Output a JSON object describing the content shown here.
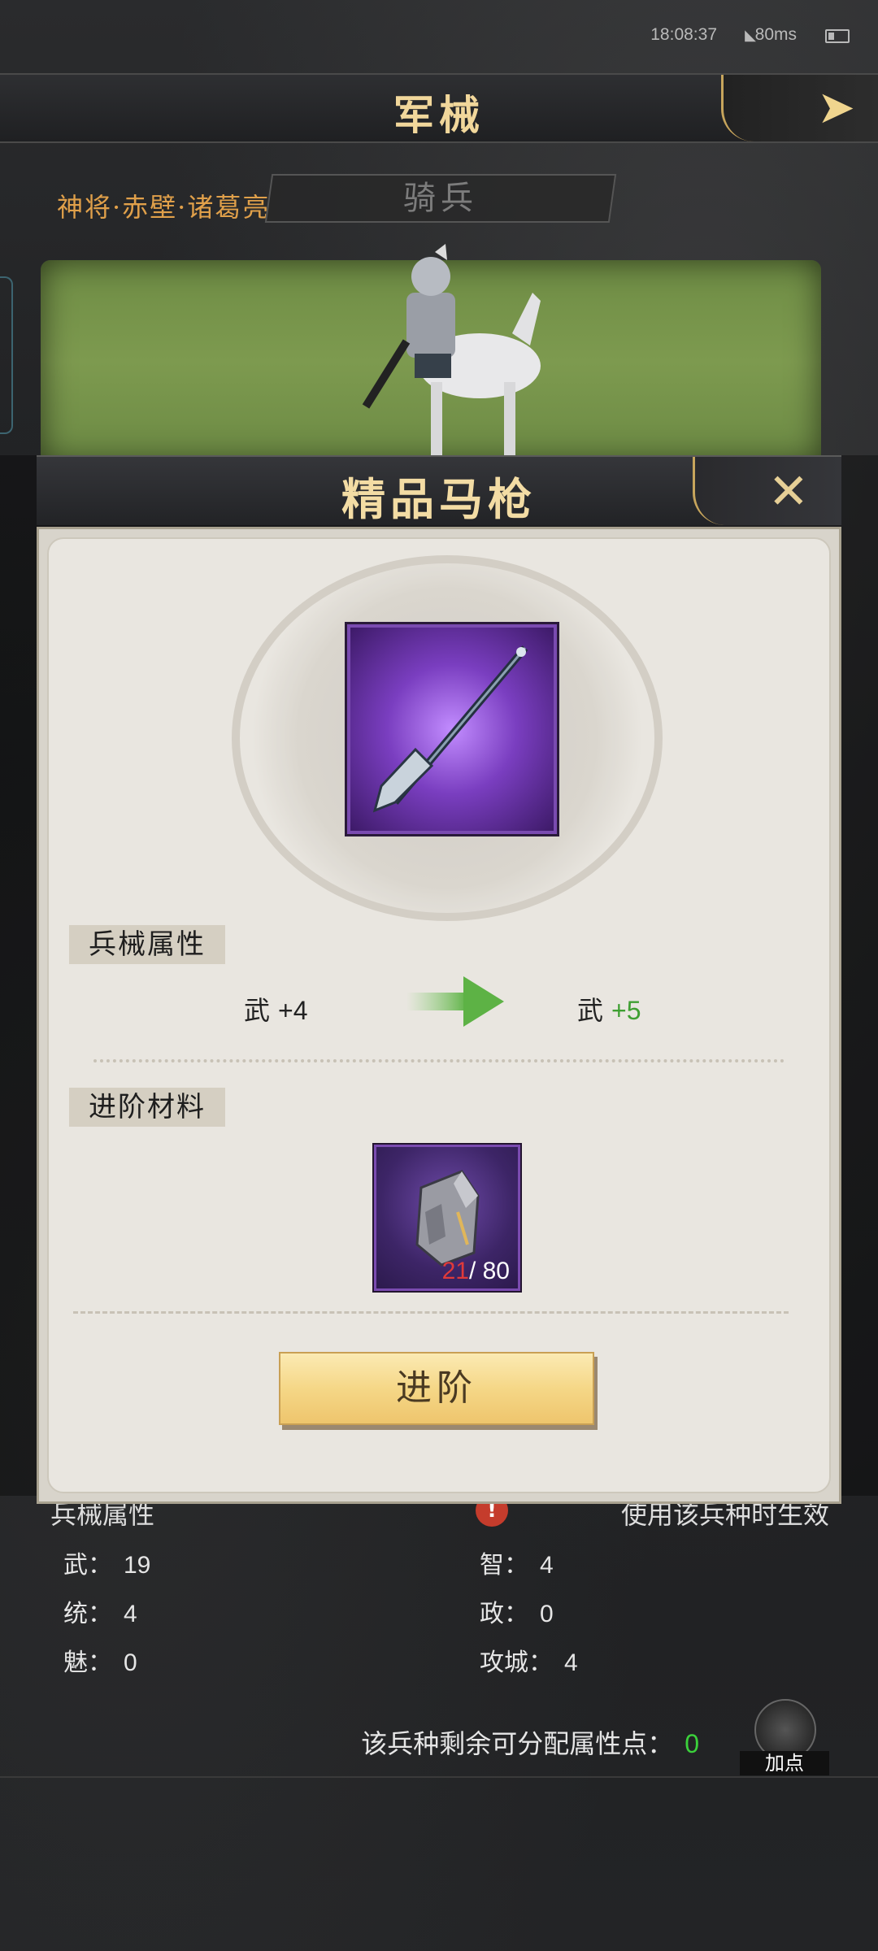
{
  "status_bar": {
    "time": "18:08:37",
    "wifi_icon": "wifi-icon",
    "ping": "80ms"
  },
  "header": {
    "title": "军械",
    "back_icon": "arrow-right-icon"
  },
  "troop": {
    "hero_name": "神将·赤壁·诸葛亮",
    "type_tab": "骑兵"
  },
  "modal": {
    "title": "精品马枪",
    "close_icon": "close-icon",
    "attr_tag": "兵械属性",
    "before_label": "武",
    "before_value": "+4",
    "after_label": "武",
    "after_value": "+5",
    "material_tag": "进阶材料",
    "material_have": "21",
    "material_need": "/ 80",
    "advance_button": "进阶"
  },
  "background_attrs": {
    "heading": "兵械属性",
    "notice": "使用该兵种时生效",
    "stats": [
      {
        "label": "武：",
        "value": "19"
      },
      {
        "label": "智：",
        "value": "4"
      },
      {
        "label": "统：",
        "value": "4"
      },
      {
        "label": "政：",
        "value": "0"
      },
      {
        "label": "魅：",
        "value": "0"
      },
      {
        "label": "攻城：",
        "value": "4"
      }
    ],
    "remaining_label": "该兵种剩余可分配属性点：",
    "remaining_value": "0",
    "add_point_button": "加点"
  },
  "colors": {
    "gold": "#f1d79b",
    "green": "#3f9f32",
    "red": "#e03a3a",
    "purple": "#7a4bb0"
  }
}
